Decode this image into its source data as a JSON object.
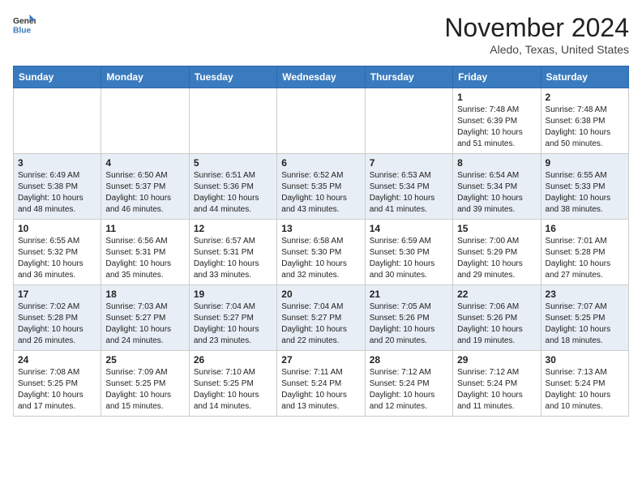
{
  "header": {
    "logo_general": "General",
    "logo_blue": "Blue",
    "month": "November 2024",
    "location": "Aledo, Texas, United States"
  },
  "days_of_week": [
    "Sunday",
    "Monday",
    "Tuesday",
    "Wednesday",
    "Thursday",
    "Friday",
    "Saturday"
  ],
  "weeks": [
    [
      {
        "day": "",
        "info": ""
      },
      {
        "day": "",
        "info": ""
      },
      {
        "day": "",
        "info": ""
      },
      {
        "day": "",
        "info": ""
      },
      {
        "day": "",
        "info": ""
      },
      {
        "day": "1",
        "info": "Sunrise: 7:48 AM\nSunset: 6:39 PM\nDaylight: 10 hours and 51 minutes."
      },
      {
        "day": "2",
        "info": "Sunrise: 7:48 AM\nSunset: 6:38 PM\nDaylight: 10 hours and 50 minutes."
      }
    ],
    [
      {
        "day": "3",
        "info": "Sunrise: 6:49 AM\nSunset: 5:38 PM\nDaylight: 10 hours and 48 minutes."
      },
      {
        "day": "4",
        "info": "Sunrise: 6:50 AM\nSunset: 5:37 PM\nDaylight: 10 hours and 46 minutes."
      },
      {
        "day": "5",
        "info": "Sunrise: 6:51 AM\nSunset: 5:36 PM\nDaylight: 10 hours and 44 minutes."
      },
      {
        "day": "6",
        "info": "Sunrise: 6:52 AM\nSunset: 5:35 PM\nDaylight: 10 hours and 43 minutes."
      },
      {
        "day": "7",
        "info": "Sunrise: 6:53 AM\nSunset: 5:34 PM\nDaylight: 10 hours and 41 minutes."
      },
      {
        "day": "8",
        "info": "Sunrise: 6:54 AM\nSunset: 5:34 PM\nDaylight: 10 hours and 39 minutes."
      },
      {
        "day": "9",
        "info": "Sunrise: 6:55 AM\nSunset: 5:33 PM\nDaylight: 10 hours and 38 minutes."
      }
    ],
    [
      {
        "day": "10",
        "info": "Sunrise: 6:55 AM\nSunset: 5:32 PM\nDaylight: 10 hours and 36 minutes."
      },
      {
        "day": "11",
        "info": "Sunrise: 6:56 AM\nSunset: 5:31 PM\nDaylight: 10 hours and 35 minutes."
      },
      {
        "day": "12",
        "info": "Sunrise: 6:57 AM\nSunset: 5:31 PM\nDaylight: 10 hours and 33 minutes."
      },
      {
        "day": "13",
        "info": "Sunrise: 6:58 AM\nSunset: 5:30 PM\nDaylight: 10 hours and 32 minutes."
      },
      {
        "day": "14",
        "info": "Sunrise: 6:59 AM\nSunset: 5:30 PM\nDaylight: 10 hours and 30 minutes."
      },
      {
        "day": "15",
        "info": "Sunrise: 7:00 AM\nSunset: 5:29 PM\nDaylight: 10 hours and 29 minutes."
      },
      {
        "day": "16",
        "info": "Sunrise: 7:01 AM\nSunset: 5:28 PM\nDaylight: 10 hours and 27 minutes."
      }
    ],
    [
      {
        "day": "17",
        "info": "Sunrise: 7:02 AM\nSunset: 5:28 PM\nDaylight: 10 hours and 26 minutes."
      },
      {
        "day": "18",
        "info": "Sunrise: 7:03 AM\nSunset: 5:27 PM\nDaylight: 10 hours and 24 minutes."
      },
      {
        "day": "19",
        "info": "Sunrise: 7:04 AM\nSunset: 5:27 PM\nDaylight: 10 hours and 23 minutes."
      },
      {
        "day": "20",
        "info": "Sunrise: 7:04 AM\nSunset: 5:27 PM\nDaylight: 10 hours and 22 minutes."
      },
      {
        "day": "21",
        "info": "Sunrise: 7:05 AM\nSunset: 5:26 PM\nDaylight: 10 hours and 20 minutes."
      },
      {
        "day": "22",
        "info": "Sunrise: 7:06 AM\nSunset: 5:26 PM\nDaylight: 10 hours and 19 minutes."
      },
      {
        "day": "23",
        "info": "Sunrise: 7:07 AM\nSunset: 5:25 PM\nDaylight: 10 hours and 18 minutes."
      }
    ],
    [
      {
        "day": "24",
        "info": "Sunrise: 7:08 AM\nSunset: 5:25 PM\nDaylight: 10 hours and 17 minutes."
      },
      {
        "day": "25",
        "info": "Sunrise: 7:09 AM\nSunset: 5:25 PM\nDaylight: 10 hours and 15 minutes."
      },
      {
        "day": "26",
        "info": "Sunrise: 7:10 AM\nSunset: 5:25 PM\nDaylight: 10 hours and 14 minutes."
      },
      {
        "day": "27",
        "info": "Sunrise: 7:11 AM\nSunset: 5:24 PM\nDaylight: 10 hours and 13 minutes."
      },
      {
        "day": "28",
        "info": "Sunrise: 7:12 AM\nSunset: 5:24 PM\nDaylight: 10 hours and 12 minutes."
      },
      {
        "day": "29",
        "info": "Sunrise: 7:12 AM\nSunset: 5:24 PM\nDaylight: 10 hours and 11 minutes."
      },
      {
        "day": "30",
        "info": "Sunrise: 7:13 AM\nSunset: 5:24 PM\nDaylight: 10 hours and 10 minutes."
      }
    ]
  ]
}
